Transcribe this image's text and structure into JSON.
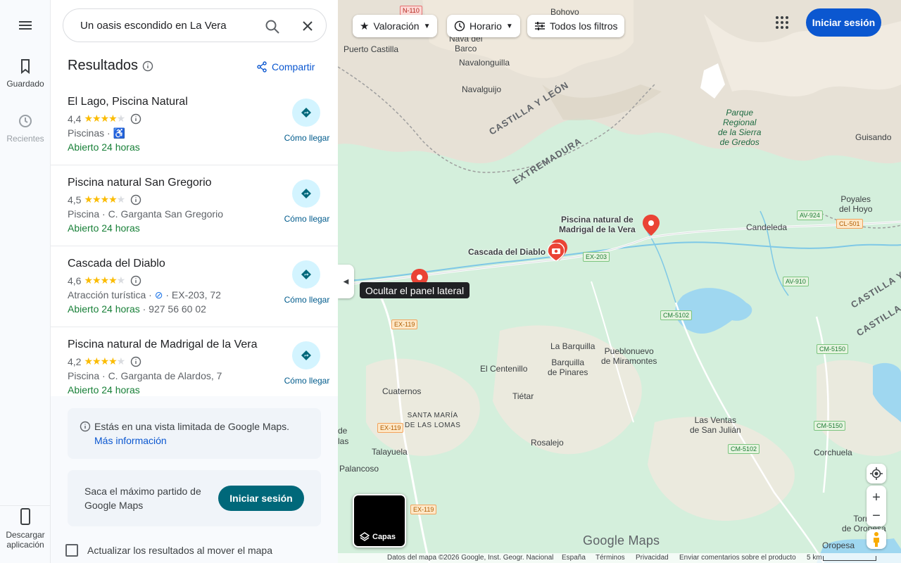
{
  "rail": {
    "saved_label": "Guardado",
    "recent_label": "Recientes",
    "download_label": "Descargar aplicación"
  },
  "search": {
    "query": "Un oasis escondido en La Vera"
  },
  "results": {
    "title": "Resultados",
    "share_label": "Compartir",
    "directions_label": "Cómo llegar",
    "items": [
      {
        "name": "El Lago, Piscina Natural",
        "rating": "4,4",
        "stars": 4.4,
        "category": "Piscinas ·",
        "hours": "Abierto 24 horas",
        "accessible": true
      },
      {
        "name": "Piscina natural San Gregorio",
        "rating": "4,5",
        "stars": 4.5,
        "category": "Piscina · C. Garganta San Gregorio",
        "hours": "Abierto 24 horas"
      },
      {
        "name": "Cascada del Diablo",
        "rating": "4,6",
        "stars": 4.6,
        "category_pre": "Atracción turística ·",
        "category_post": "· EX-203, 72",
        "hours": "Abierto 24 horas",
        "phone": "· 927 56 60 02"
      },
      {
        "name": "Piscina natural de Madrigal de la Vera",
        "rating": "4,2",
        "stars": 4.2,
        "category": "Piscina · C. Garganta de Alardos, 7",
        "hours": "Abierto 24 horas"
      }
    ]
  },
  "notice": {
    "text": "Estás en una vista limitada de Google Maps.",
    "link": "Más información"
  },
  "promo": {
    "text": "Saca el máximo partido de Google Maps",
    "button": "Iniciar sesión"
  },
  "update_checkbox_label": "Actualizar los resultados al mover el mapa",
  "map": {
    "chips": {
      "rating": "Valoración",
      "hours": "Horario",
      "filters": "Todos los filtros"
    },
    "signin": "Iniciar sesión",
    "tooltip": "Ocultar el panel lateral",
    "layers": "Capas",
    "logo": "Google Maps",
    "places": {
      "bohoyo": "Bohoyo",
      "navadelbarco": "Nava del\nBarco",
      "puertocastilla": "Puerto Castilla",
      "navalonguilla": "Navalonguilla",
      "navalguijo": "Navalguijo",
      "parque": "Parque\nRegional\nde la Sierra\nde Gredos",
      "guisando": "Guisando",
      "poyales": "Poyales\ndel Hoyo",
      "candeleda": "Candeleda",
      "labarquilla": "La Barquilla",
      "pueblonuevo": "Pueblonuevo\nde Miramontes",
      "barquilla": "Barquilla\nde Pinares",
      "elcentenillo": "El Centenillo",
      "cuaternos": "Cuaternos",
      "tietar": "Tiétar",
      "santamaria": "SANTA MARÍA\nDE LAS LOMAS",
      "talayuela": "Talayuela",
      "rosalejo": "Rosalejo",
      "lasventas": "Las Ventas\nde San Julián",
      "palancoso": "Palancoso",
      "corchuela": "Corchuela",
      "torral": "Torral\nde Oropesa",
      "oropesa": "Oropesa",
      "de": "de",
      "las": "las"
    },
    "regions": {
      "cyl": "CASTILLA Y LEÓN",
      "ext": "EXTREMADURA",
      "cyl2": "CASTILLA Y L",
      "cylm": "CASTILLA-LA"
    },
    "pois": {
      "madrigal": "Piscina natural de\nMadrigal de la Vera",
      "cascada": "Cascada del Diablo"
    },
    "roads": {
      "n110": "N-110",
      "av924": "AV-924",
      "cl501": "CL-501",
      "ex203": "EX-203",
      "av910": "AV-910",
      "cm5102": "CM-5102",
      "ex119a": "EX-119",
      "cm5150a": "CM-5150",
      "ex119b": "EX-119",
      "cm5150b": "CM-5150",
      "cm5102b": "CM-5102",
      "ex119c": "EX-119"
    },
    "attribution": {
      "data": "Datos del mapa ©2026 Google, Inst. Geogr. Nacional",
      "country": "España",
      "terms": "Términos",
      "privacy": "Privacidad",
      "feedback": "Enviar comentarios sobre el producto",
      "scale": "5 km"
    }
  },
  "colors": {
    "accent": "#0b57d0",
    "open": "#188038",
    "star": "#fbbc04",
    "teal_button": "#00687a"
  }
}
